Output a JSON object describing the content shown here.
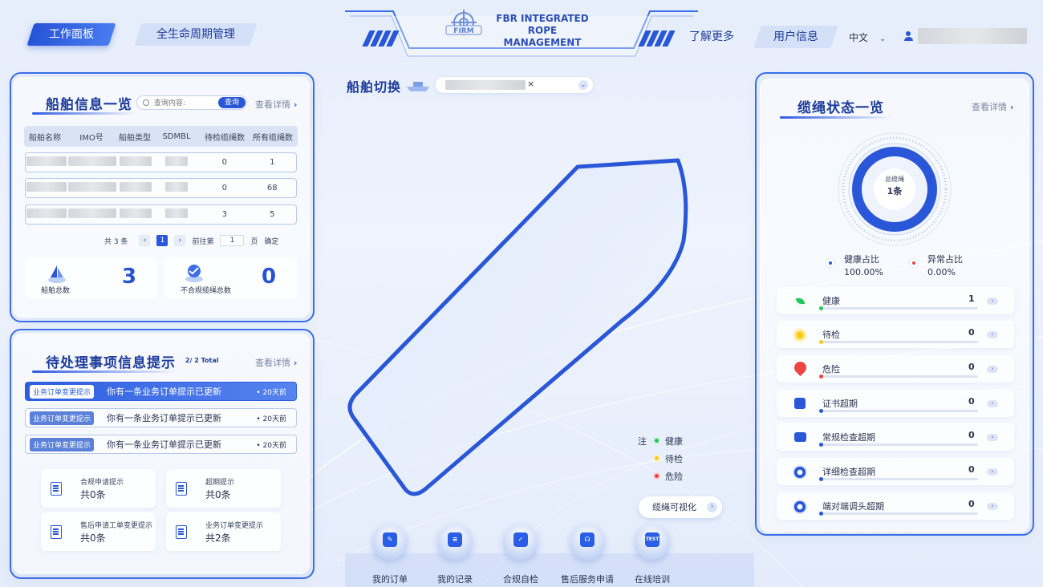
{
  "header": {
    "tabs": [
      {
        "label": "工作面板",
        "active": true
      },
      {
        "label": "全生命周期管理",
        "active": false
      }
    ],
    "brand": {
      "logo_text": "FIRM",
      "line1": "FBR INTEGRATED ROPE",
      "line2": "MANAGEMENT"
    },
    "right_tabs": [
      {
        "label": "了解更多"
      },
      {
        "label": "用户信息"
      }
    ],
    "language": "中文",
    "accent": "#2a56d8"
  },
  "ship_info": {
    "title": "船舶信息一览",
    "search_placeholder": "查询内容:",
    "search_button": "查询",
    "more": "查看详情",
    "columns": [
      "船舶名称",
      "IMO号",
      "船舶类型",
      "SDMBL",
      "待检缆绳数",
      "所有缆绳数"
    ],
    "rows": [
      {
        "pending": "0",
        "total": "1"
      },
      {
        "pending": "0",
        "total": "68"
      },
      {
        "pending": "3",
        "total": "5"
      }
    ],
    "pagination": {
      "total": "共 3 条",
      "prev": "‹",
      "page": "1",
      "next": "›",
      "goto": "前往第",
      "goto_value": "1",
      "unit": "页",
      "confirm": "确定"
    },
    "stats": [
      {
        "label": "船舶总数",
        "value": "3"
      },
      {
        "label": "不合规缆绳总数",
        "value": "0"
      }
    ]
  },
  "pending": {
    "title": "待处理事项信息提示",
    "count": "2/ 2 Total",
    "more": "查看详情",
    "items": [
      {
        "tag": "业务订单变更提示",
        "message": "你有一条业务订单提示已更新",
        "time": "20天前",
        "active": true
      },
      {
        "tag": "业务订单变更提示",
        "message": "你有一条业务订单提示已更新",
        "time": "20天前",
        "active": false
      },
      {
        "tag": "业务订单变更提示",
        "message": "你有一条业务订单提示已更新",
        "time": "20天前",
        "active": false
      }
    ],
    "cards": [
      {
        "title": "合规申请提示",
        "count": "共0条"
      },
      {
        "title": "超期提示",
        "count": "共0条"
      },
      {
        "title": "售后申请工单变更提示",
        "count": "共0条"
      },
      {
        "title": "业务订单变更提示",
        "count": "共2条"
      }
    ]
  },
  "center": {
    "switch_label": "船舶切换",
    "select_clear": "×",
    "legend_title": "注",
    "legend": [
      {
        "label": "健康",
        "color": "#22c55e"
      },
      {
        "label": "待检",
        "color": "#facc15"
      },
      {
        "label": "危险",
        "color": "#ef4444"
      }
    ],
    "visualize_button": "缆绳可视化"
  },
  "bottom_nav": [
    {
      "label": "我的订单",
      "icon": "order-icon",
      "glyph": "✎"
    },
    {
      "label": "我的记录",
      "icon": "record-icon",
      "glyph": "≡"
    },
    {
      "label": "合规自检",
      "icon": "shield-check-icon",
      "glyph": "✓"
    },
    {
      "label": "售后服务申请",
      "icon": "headset-icon",
      "glyph": "☊"
    },
    {
      "label": "在线培训",
      "icon": "test-icon",
      "glyph": "TEST"
    }
  ],
  "rope_status": {
    "title": "缆绳状态一览",
    "more": "查看详情",
    "gauge": {
      "label": "总缆绳",
      "value": "1条",
      "healthy_fraction": 1.0
    },
    "ratios": [
      {
        "label": "健康占比",
        "value": "100.00%",
        "color": "#2a56d8"
      },
      {
        "label": "异常占比",
        "value": "0.00%",
        "color": "#ef4444"
      }
    ],
    "rows": [
      {
        "label": "健康",
        "value": "1",
        "icon": "leaf-icon",
        "color": "#22c55e"
      },
      {
        "label": "待检",
        "value": "0",
        "icon": "sun-icon",
        "color": "#facc15"
      },
      {
        "label": "危险",
        "value": "0",
        "icon": "warning-icon",
        "color": "#ef4444"
      },
      {
        "label": "证书超期",
        "value": "0",
        "icon": "certificate-icon",
        "color": "#2a56d8"
      },
      {
        "label": "常规检查超期",
        "value": "0",
        "icon": "inbox-icon",
        "color": "#2a56d8"
      },
      {
        "label": "详细检查超期",
        "value": "0",
        "icon": "search-circle-icon",
        "color": "#2a56d8"
      },
      {
        "label": "端对端调头超期",
        "value": "0",
        "icon": "swap-circle-icon",
        "color": "#2a56d8"
      }
    ]
  }
}
